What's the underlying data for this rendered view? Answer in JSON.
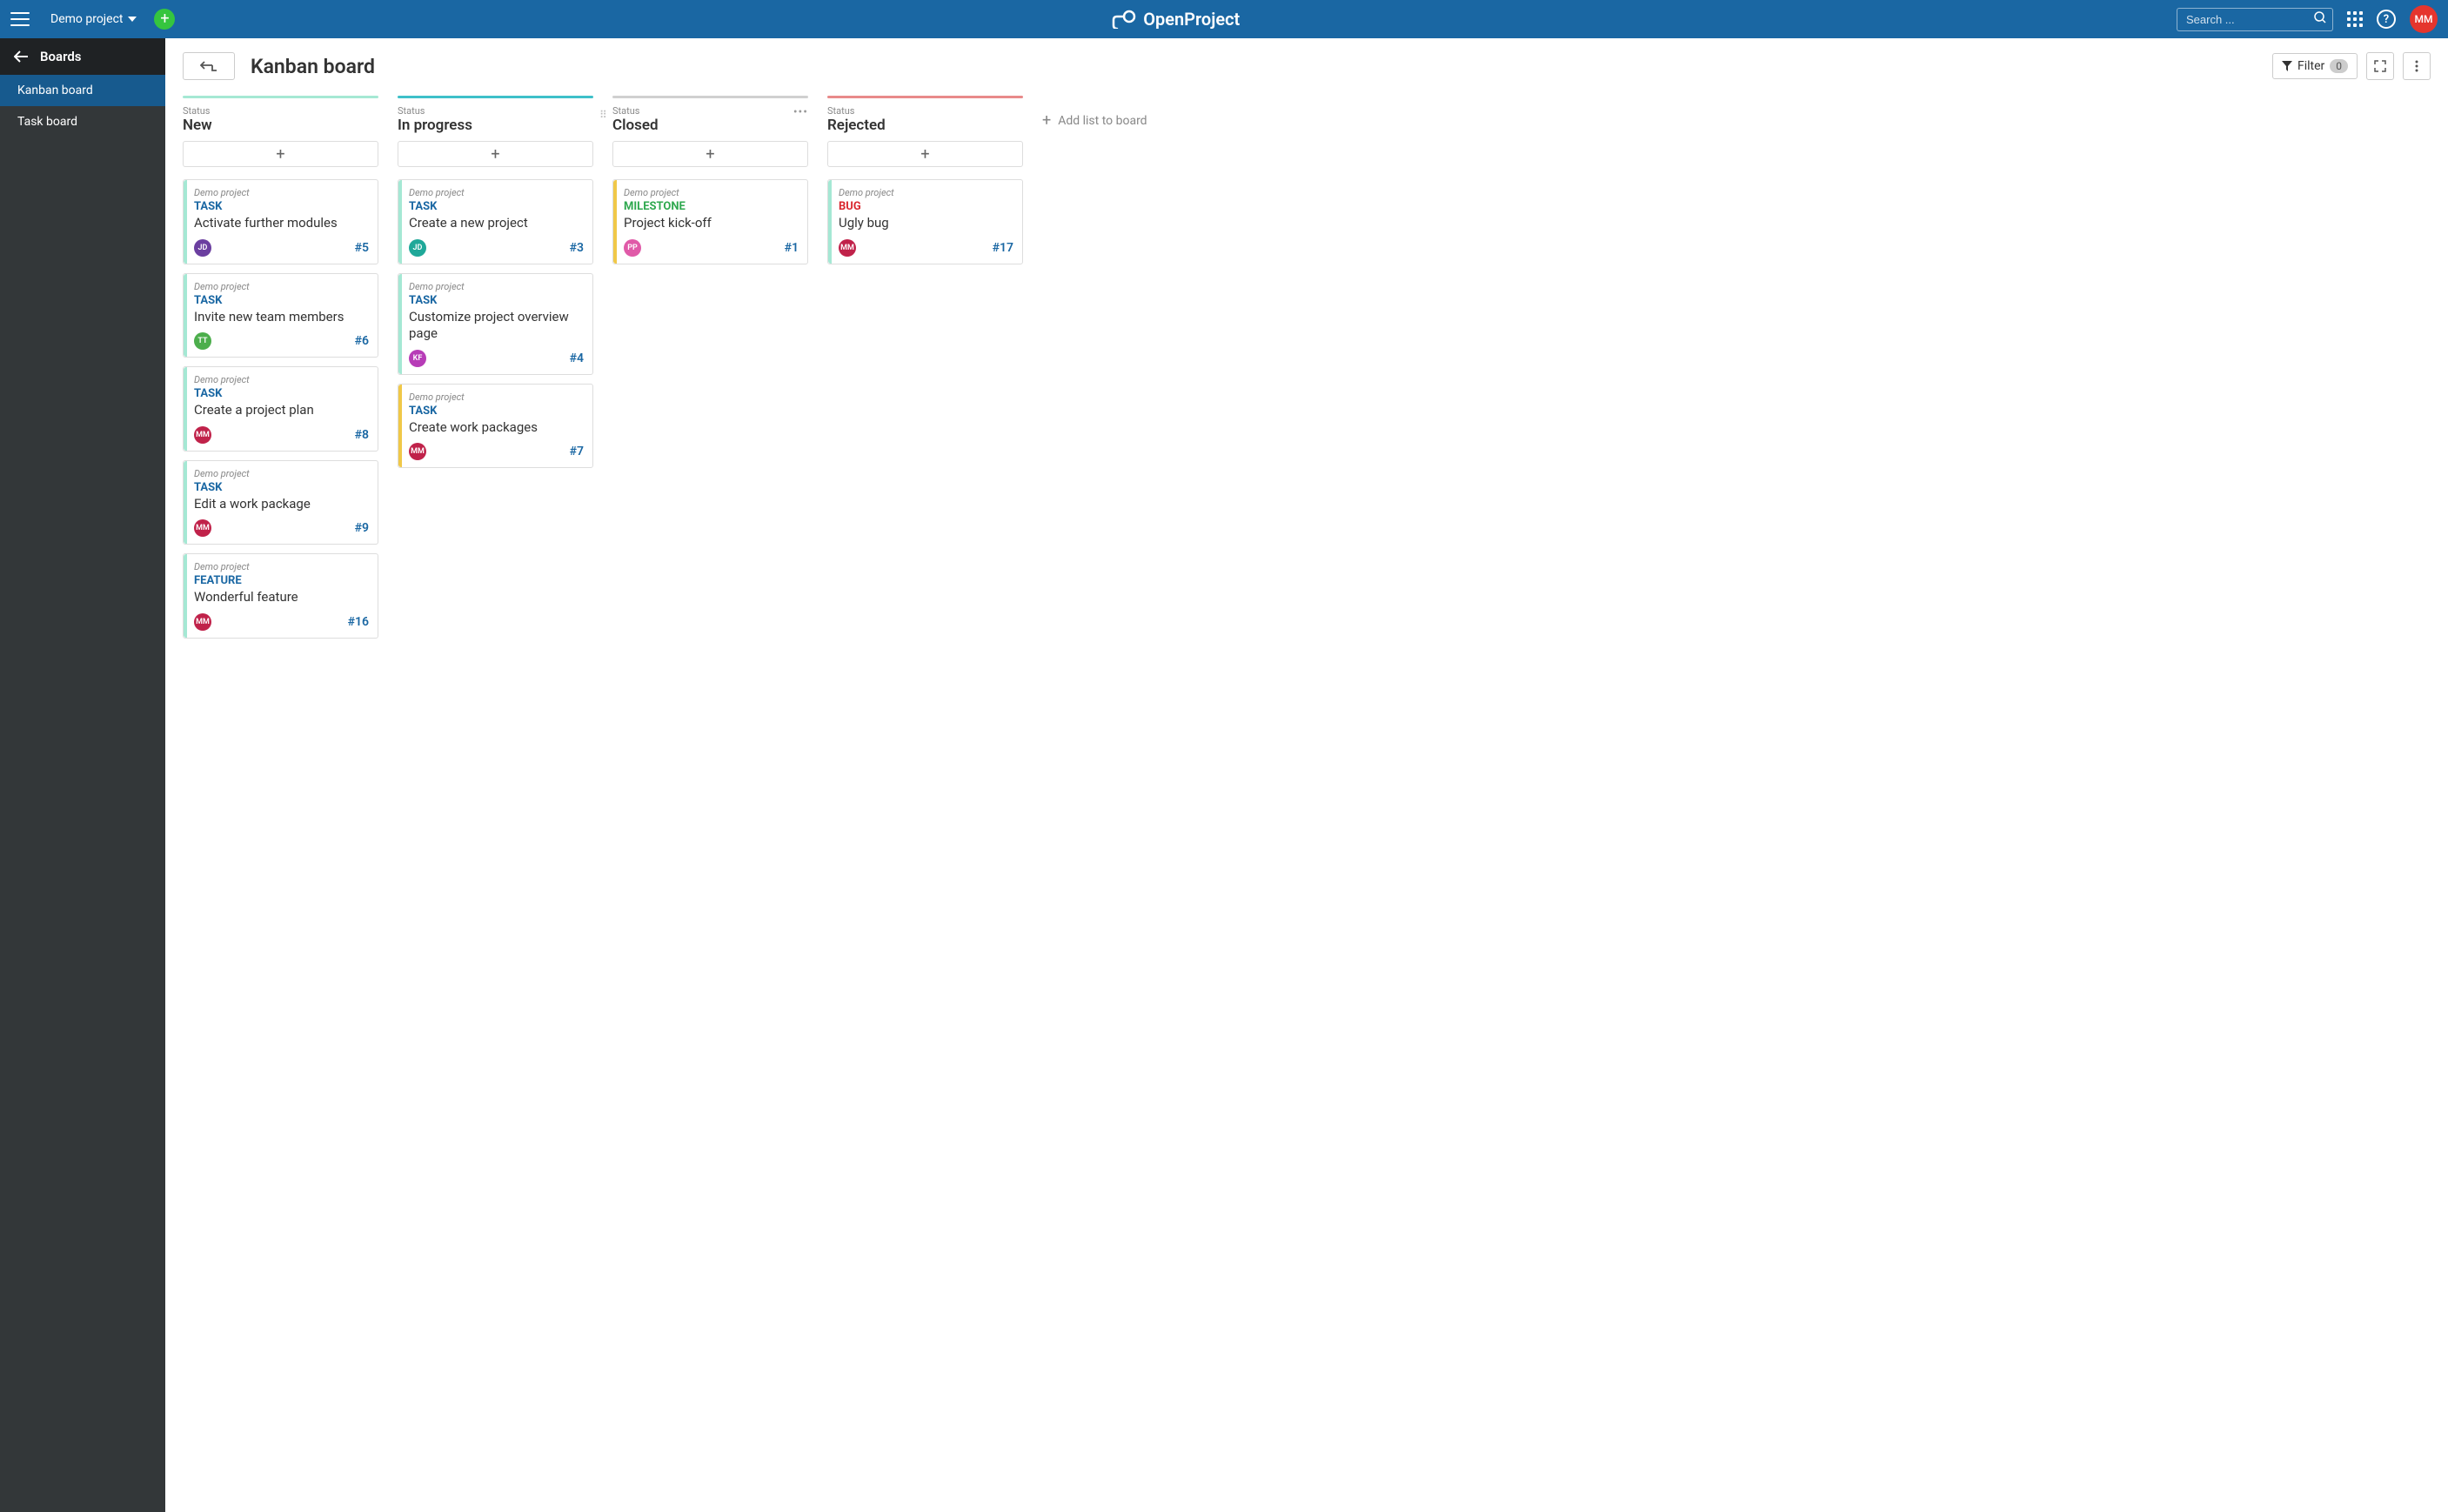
{
  "topbar": {
    "project_name": "Demo project",
    "search_placeholder": "Search ...",
    "app_name": "OpenProject",
    "user_initials": "MM"
  },
  "sidebar": {
    "title": "Boards",
    "items": [
      {
        "label": "Kanban board",
        "active": true
      },
      {
        "label": "Task board",
        "active": false
      }
    ]
  },
  "board": {
    "title": "Kanban board",
    "filter_label": "Filter",
    "filter_count": "0",
    "add_list_label": "Add list to board",
    "status_label": "Status",
    "columns": [
      {
        "title": "New",
        "bar_color": "#a5e8d4",
        "show_drag": false,
        "show_actions": false,
        "cards": [
          {
            "project": "Demo project",
            "type": "TASK",
            "type_color": "#1a67a3",
            "stripe": "#a5e8d4",
            "title": "Activate further modules",
            "id": "#5",
            "avatar_text": "JD",
            "avatar_bg": "#6b3fa0"
          },
          {
            "project": "Demo project",
            "type": "TASK",
            "type_color": "#1a67a3",
            "stripe": "#a5e8d4",
            "title": "Invite new team members",
            "id": "#6",
            "avatar_text": "TT",
            "avatar_bg": "#4cae4c"
          },
          {
            "project": "Demo project",
            "type": "TASK",
            "type_color": "#1a67a3",
            "stripe": "#a5e8d4",
            "title": "Create a project plan",
            "id": "#8",
            "avatar_text": "MM",
            "avatar_bg": "#c0224a"
          },
          {
            "project": "Demo project",
            "type": "TASK",
            "type_color": "#1a67a3",
            "stripe": "#a5e8d4",
            "title": "Edit a work package",
            "id": "#9",
            "avatar_text": "MM",
            "avatar_bg": "#c0224a"
          },
          {
            "project": "Demo project",
            "type": "FEATURE",
            "type_color": "#1a67a3",
            "stripe": "#a5e8d4",
            "title": "Wonderful feature",
            "id": "#16",
            "avatar_text": "MM",
            "avatar_bg": "#c0224a"
          }
        ]
      },
      {
        "title": "In progress",
        "bar_color": "#3fc0c9",
        "show_drag": false,
        "show_actions": false,
        "cards": [
          {
            "project": "Demo project",
            "type": "TASK",
            "type_color": "#1a67a3",
            "stripe": "#a5e8d4",
            "title": "Create a new project",
            "id": "#3",
            "avatar_text": "JD",
            "avatar_bg": "#1fa899"
          },
          {
            "project": "Demo project",
            "type": "TASK",
            "type_color": "#1a67a3",
            "stripe": "#a5e8d4",
            "title": "Customize project overview page",
            "id": "#4",
            "avatar_text": "KF",
            "avatar_bg": "#b73cb7"
          },
          {
            "project": "Demo project",
            "type": "TASK",
            "type_color": "#1a67a3",
            "stripe": "#f0c848",
            "title": "Create work packages",
            "id": "#7",
            "avatar_text": "MM",
            "avatar_bg": "#c0224a"
          }
        ]
      },
      {
        "title": "Closed",
        "bar_color": "#d0d0d0",
        "show_drag": true,
        "show_actions": true,
        "cards": [
          {
            "project": "Demo project",
            "type": "MILESTONE",
            "type_color": "#2fa84f",
            "stripe": "#f0c848",
            "title": "Project kick-off",
            "id": "#1",
            "avatar_text": "PP",
            "avatar_bg": "#e05aa8"
          }
        ]
      },
      {
        "title": "Rejected",
        "bar_color": "#e88a8a",
        "show_drag": false,
        "show_actions": false,
        "cards": [
          {
            "project": "Demo project",
            "type": "BUG",
            "type_color": "#d9272e",
            "stripe": "#a5e8d4",
            "title": "Ugly bug",
            "id": "#17",
            "avatar_text": "MM",
            "avatar_bg": "#c0224a"
          }
        ]
      }
    ]
  }
}
